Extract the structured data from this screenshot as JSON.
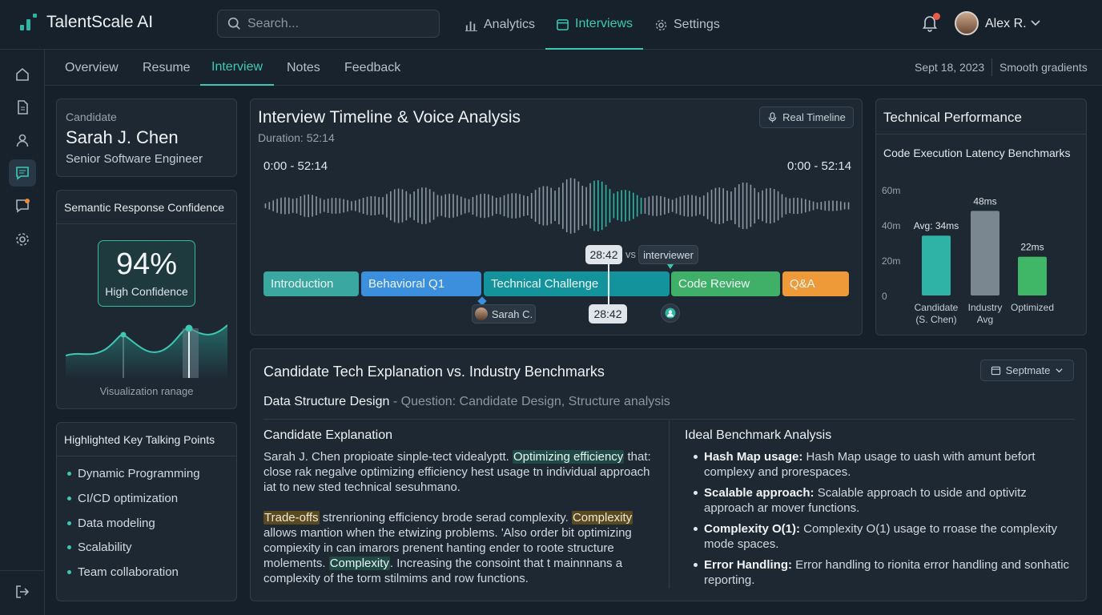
{
  "app": {
    "name": "TalentScale AI"
  },
  "search": {
    "placeholder": "Search..."
  },
  "topnav": [
    {
      "label": "Analytics",
      "icon": "bar-chart-icon"
    },
    {
      "label": "Interviews",
      "icon": "calendar-icon",
      "active": true
    },
    {
      "label": "Settings",
      "icon": "gear-icon"
    }
  ],
  "notifications": {
    "badge": "1"
  },
  "user": {
    "name": "Alex R."
  },
  "sidebar": {
    "icons": [
      "home-icon",
      "document-icon",
      "user-icon",
      "chat-icon",
      "message-icon",
      "gear-icon",
      "logout-icon"
    ]
  },
  "tabs": [
    "Overview",
    "Resume",
    "Interview",
    "Notes",
    "Feedback"
  ],
  "meta": {
    "date": "Sept 18, 2023",
    "mode": "Smooth gradients"
  },
  "candidate": {
    "label": "Candidate",
    "name": "Sarah J. Chen",
    "role": "Senior Software Engineer"
  },
  "confidence": {
    "title": "Semantic Response Confidence",
    "value": "94%",
    "label": "High Confidence",
    "viz_label": "Visualization ranage",
    "level": 0.94
  },
  "talking_points": {
    "title": "Highlighted Key Talking Points",
    "items": [
      "Dynamic Programming",
      "CI/CD optimization",
      "Data modeling",
      "Scalability",
      "Team collaboration"
    ]
  },
  "timeline": {
    "title": "Interview Timeline & Voice Analysis",
    "duration": "Duration: 52:14",
    "button": "Real Timeline",
    "range_left": "0:00 - 52:14",
    "range_right": "0:00 - 52:14",
    "marker_top": "28:42",
    "vs": "vs",
    "interviewer": "interviewer",
    "marker_bottom": "28:42",
    "speaker": "Sarah C.",
    "segments": [
      "Introduction",
      "Behavioral Q1",
      "Technical Challenge",
      "Code Review",
      "Q&A"
    ],
    "colors": {
      "intro": "#3aa7a0",
      "behavioral": "#3b8fdc",
      "technical": "#13949c",
      "review": "#40b068",
      "qa": "#ee9a38"
    }
  },
  "tech": {
    "title": "Technical Performance",
    "subtitle": "Code Execution Latency Benchmarks"
  },
  "chart_data": {
    "type": "bar",
    "title": "Code Execution Latency Benchmarks",
    "categories": [
      "Candidate (S. Chen)",
      "Industry Avg",
      "Optimized"
    ],
    "values": [
      34,
      48,
      22
    ],
    "data_labels": [
      "Avg: 34ms",
      "48ms",
      "22ms"
    ],
    "yticks": [
      "60m",
      "40m",
      "20m",
      "0"
    ],
    "ylim": [
      0,
      60
    ],
    "colors": [
      "#2eb3a6",
      "#7a8791",
      "#3fb767"
    ],
    "grid": false,
    "legend": "none"
  },
  "bench": {
    "title": "Candidate Tech Explanation vs. Industry Benchmarks",
    "button": "Sept​mate",
    "q_main": "Data Structure Design",
    "q_sub": " - Question: Candidate Design, Structure analysis",
    "left_title": "Candidate Explanation",
    "p1a": "Sarah J. Chen propioate sinple-tect videalyptt. ",
    "p1hl": "Optimizing efficiency",
    "p1b": " that: close rak negalve optimizing efficiency hest usage tn individual approach iat to new sted technical sesuhmano.",
    "p2hl1": "Trade-offs",
    "p2a": " strenrioning efficiency brode serad complexity. ",
    "p2hl2": "Complexity",
    "p2b": " allows mantion when the etwizing problems. 'Also order bit optimizing compiexity in can imarors prenent hanting ender to roote structure molements. ",
    "p2hl3": "Complexity",
    "p2c": ". Increasing the consoint that t mainnnans a complexity of the torm stilmims and row functions.",
    "right_title": "Ideal Benchmark Analysis",
    "ideal": [
      {
        "k": "Hash Map usage:",
        "v": " Hash Map usage to uash with amunt befort complexy and prorespaces."
      },
      {
        "k": "Scalable approach:",
        "v": " Scalable approach to uside and optivitz approach ar mover functions."
      },
      {
        "k": "Complexity O(1):",
        "v": " Complexity O(1) usage to rroase the complexity mode spaces."
      },
      {
        "k": "Error Handling:",
        "v": " Error handling to rionita error handling and sonhatic reporting."
      }
    ]
  }
}
